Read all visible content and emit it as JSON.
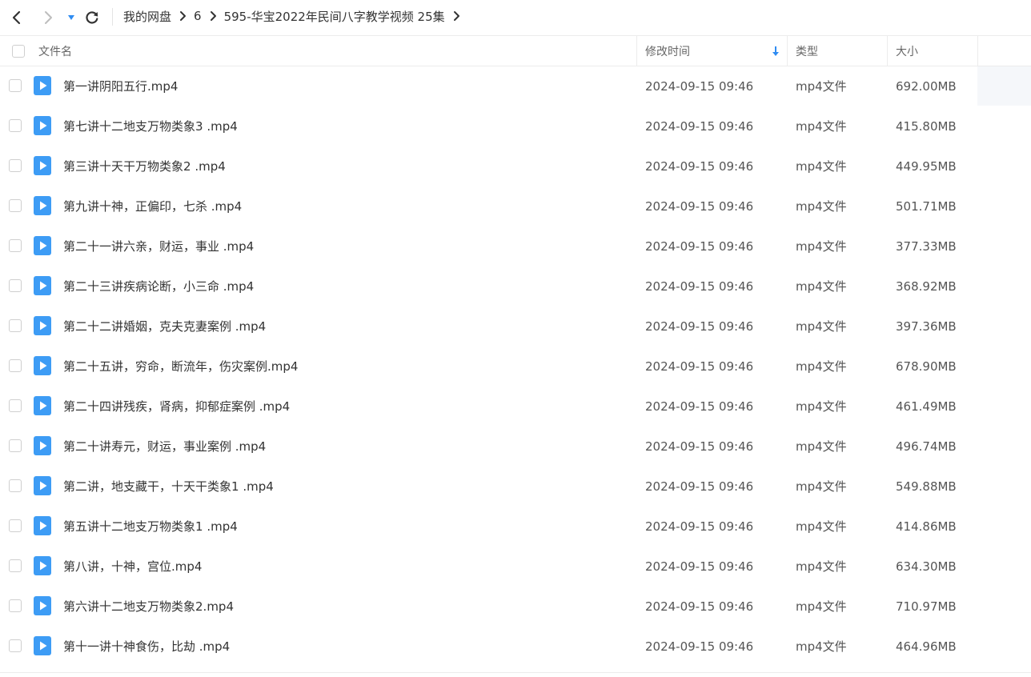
{
  "nav": {
    "back_icon": "chevron-left-icon",
    "forward_icon": "chevron-right-icon",
    "dropdown_icon": "caret-down-icon",
    "refresh_icon": "refresh-icon",
    "accent": "#2f8cf2"
  },
  "breadcrumb": [
    {
      "label": "我的网盘"
    },
    {
      "label": "6"
    },
    {
      "label": "595-华宝2022年民间八字教学视频 25集"
    }
  ],
  "columns": {
    "name": "文件名",
    "modified": "修改时间",
    "type": "类型",
    "size": "大小",
    "sort_icon": "arrow-down-icon"
  },
  "files": [
    {
      "name": "第一讲阴阳五行.mp4",
      "modified": "2024-09-15 09:46",
      "type": "mp4文件",
      "size": "692.00MB"
    },
    {
      "name": "第七讲十二地支万物类象3 .mp4",
      "modified": "2024-09-15 09:46",
      "type": "mp4文件",
      "size": "415.80MB"
    },
    {
      "name": "第三讲十天干万物类象2 .mp4",
      "modified": "2024-09-15 09:46",
      "type": "mp4文件",
      "size": "449.95MB"
    },
    {
      "name": "第九讲十神，正偏印，七杀 .mp4",
      "modified": "2024-09-15 09:46",
      "type": "mp4文件",
      "size": "501.71MB"
    },
    {
      "name": "第二十一讲六亲，财运，事业 .mp4",
      "modified": "2024-09-15 09:46",
      "type": "mp4文件",
      "size": "377.33MB"
    },
    {
      "name": "第二十三讲疾病论断，小三命 .mp4",
      "modified": "2024-09-15 09:46",
      "type": "mp4文件",
      "size": "368.92MB"
    },
    {
      "name": "第二十二讲婚姻，克夫克妻案例 .mp4",
      "modified": "2024-09-15 09:46",
      "type": "mp4文件",
      "size": "397.36MB"
    },
    {
      "name": "第二十五讲，穷命，断流年，伤灾案例.mp4",
      "modified": "2024-09-15 09:46",
      "type": "mp4文件",
      "size": "678.90MB"
    },
    {
      "name": "第二十四讲残疾，肾病，抑郁症案例 .mp4",
      "modified": "2024-09-15 09:46",
      "type": "mp4文件",
      "size": "461.49MB"
    },
    {
      "name": "第二十讲寿元，财运，事业案例 .mp4",
      "modified": "2024-09-15 09:46",
      "type": "mp4文件",
      "size": "496.74MB"
    },
    {
      "name": "第二讲，地支藏干，十天干类象1 .mp4",
      "modified": "2024-09-15 09:46",
      "type": "mp4文件",
      "size": "549.88MB"
    },
    {
      "name": "第五讲十二地支万物类象1 .mp4",
      "modified": "2024-09-15 09:46",
      "type": "mp4文件",
      "size": "414.86MB"
    },
    {
      "name": "第八讲，十神，宫位.mp4",
      "modified": "2024-09-15 09:46",
      "type": "mp4文件",
      "size": "634.30MB"
    },
    {
      "name": "第六讲十二地支万物类象2.mp4",
      "modified": "2024-09-15 09:46",
      "type": "mp4文件",
      "size": "710.97MB"
    },
    {
      "name": "第十一讲十神食伤，比劫 .mp4",
      "modified": "2024-09-15 09:46",
      "type": "mp4文件",
      "size": "464.96MB"
    }
  ],
  "file_icon": "video-file-icon",
  "file_icon_color": "#3d9cf5"
}
